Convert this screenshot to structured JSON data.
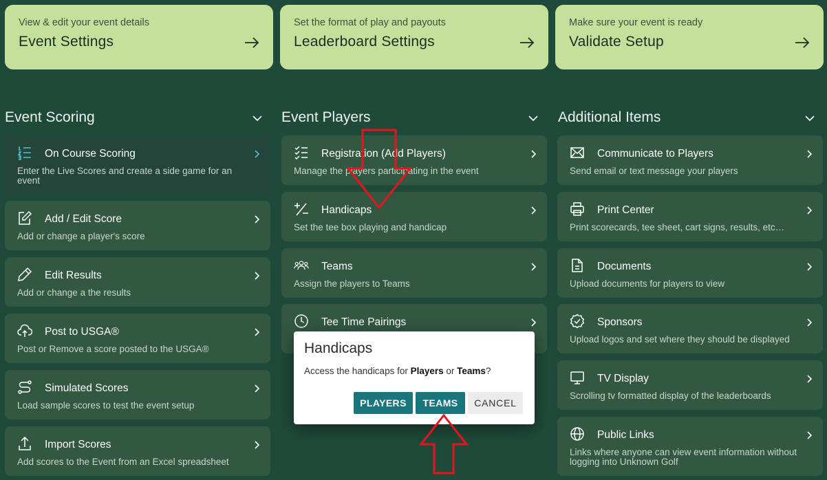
{
  "top_cards": [
    {
      "subtitle": "View & edit your event details",
      "title": "Event Settings"
    },
    {
      "subtitle": "Set the format of play and payouts",
      "title": "Leaderboard Settings"
    },
    {
      "subtitle": "Make sure your event is ready",
      "title": "Validate Setup"
    }
  ],
  "sections": {
    "scoring": {
      "title": "Event Scoring",
      "items": [
        {
          "title": "On Course Scoring",
          "desc": "Enter the Live Scores and create a side game for an event",
          "icon": "numbered-list-icon"
        },
        {
          "title": "Add / Edit Score",
          "desc": "Add or change a player's score",
          "icon": "edit-square-icon"
        },
        {
          "title": "Edit Results",
          "desc": "Add or change a the results",
          "icon": "pencil-icon"
        },
        {
          "title": "Post to USGA®",
          "desc": "Post or Remove a score posted to the USGA®",
          "icon": "cloud-upload-icon"
        },
        {
          "title": "Simulated Scores",
          "desc": "Load sample scores to test the event setup",
          "icon": "route-icon"
        },
        {
          "title": "Import Scores",
          "desc": "Add scores to the Event from an Excel spreadsheet",
          "icon": "upload-icon"
        }
      ]
    },
    "players": {
      "title": "Event Players",
      "items": [
        {
          "title": "Registration (Add Players)",
          "desc": "Manage the players participating in the event",
          "icon": "checklist-icon"
        },
        {
          "title": "Handicaps",
          "desc": "Set the tee box playing and handicap",
          "icon": "plus-minus-icon"
        },
        {
          "title": "Teams",
          "desc": "Assign the players to Teams",
          "icon": "group-icon"
        },
        {
          "title": "Tee Time Pairings",
          "desc": "",
          "icon": "clock-icon"
        }
      ]
    },
    "additional": {
      "title": "Additional Items",
      "items": [
        {
          "title": "Communicate to Players",
          "desc": "Send email or text message your players",
          "icon": "mail-icon"
        },
        {
          "title": "Print Center",
          "desc": "Print scorecards, tee sheet, cart signs, results, etc…",
          "icon": "printer-icon"
        },
        {
          "title": "Documents",
          "desc": "Upload documents for players to view",
          "icon": "document-icon"
        },
        {
          "title": "Sponsors",
          "desc": "Upload logos and set where they should be displayed",
          "icon": "badge-check-icon"
        },
        {
          "title": "TV Display",
          "desc": "Scrolling tv formatted display of the leaderboards",
          "icon": "monitor-icon"
        },
        {
          "title": "Public Links",
          "desc": "Links where anyone can view event information without logging into Unknown Golf",
          "icon": "globe-icon"
        }
      ]
    }
  },
  "modal": {
    "title": "Handicaps",
    "body_prefix": "Access the handicaps for ",
    "body_bold1": "Players",
    "body_middle": " or ",
    "body_bold2": "Teams",
    "body_suffix": "?",
    "btn_players": "PLAYERS",
    "btn_teams": "TEAMS",
    "btn_cancel": "CANCEL"
  },
  "colors": {
    "background": "#1f4a3a",
    "card": "#325842",
    "top_card": "#c6df9a",
    "accent": "#17777c",
    "annotation": "#e8141c"
  }
}
